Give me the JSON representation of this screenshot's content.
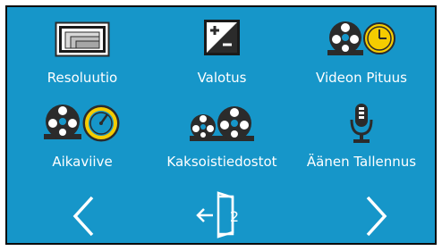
{
  "menu": {
    "items": [
      {
        "label": "Resoluutio",
        "icon": "resolution-icon"
      },
      {
        "label": "Valotus",
        "icon": "exposure-icon"
      },
      {
        "label": "Videon Pituus",
        "icon": "video-length-icon"
      },
      {
        "label": "Aikaviive",
        "icon": "timelapse-icon"
      },
      {
        "label": "Kaksoistiedostot",
        "icon": "dual-files-icon"
      },
      {
        "label": "Äänen Tallennus",
        "icon": "audio-recording-icon"
      }
    ]
  },
  "footer": {
    "page_number": "2",
    "prev_icon": "chevron-left-icon",
    "exit_icon": "exit-door-icon",
    "next_icon": "chevron-right-icon"
  },
  "colors": {
    "background": "#1696c9",
    "icon_dark": "#2b2b2b",
    "icon_light": "#ffffff",
    "clock_yellow": "#f5cc00"
  }
}
